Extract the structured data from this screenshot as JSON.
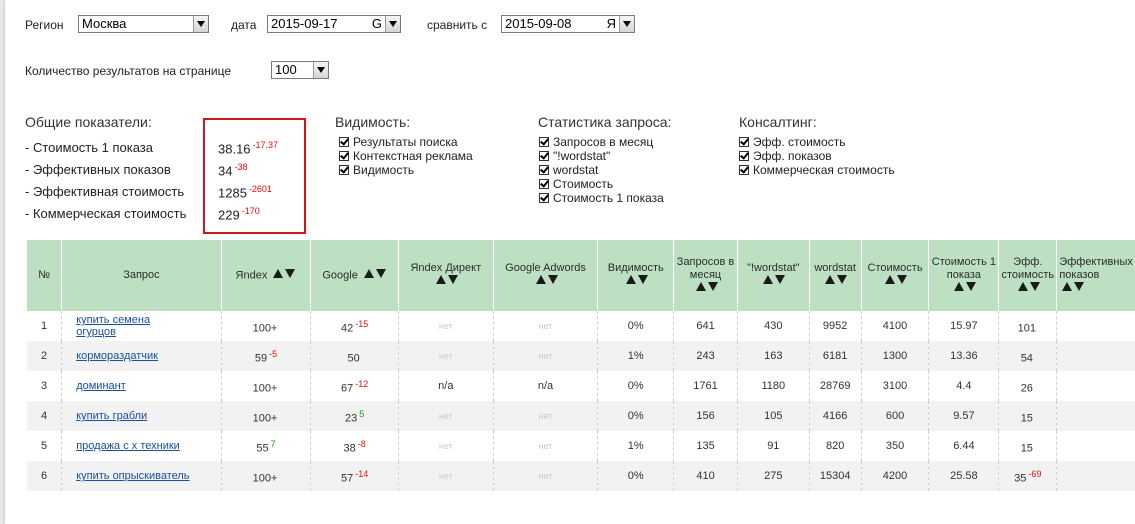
{
  "filters": {
    "region_label": "Регион",
    "region_value": "Москва",
    "date_label": "дата",
    "date_value": "2015-09-17",
    "date_suffix": "G",
    "compare_label": "сравнить с",
    "compare_value": "2015-09-08",
    "compare_suffix": "Я",
    "per_page_label": "Количество результатов на странице",
    "per_page_value": "100"
  },
  "summary": {
    "title": "Общие показатели:",
    "rows": [
      {
        "label": "- Стоимость 1 показа",
        "value": "38.16",
        "delta": "-17.37"
      },
      {
        "label": "- Эффективных показов",
        "value": "34",
        "delta": "-38"
      },
      {
        "label": "- Эффективная стоимость",
        "value": "1285",
        "delta": "-2601"
      },
      {
        "label": "- Коммерческая стоимость",
        "value": "229",
        "delta": "-170"
      }
    ],
    "highlight_color": "#d4141c"
  },
  "visibility": {
    "title": "Видимость:",
    "options": [
      "Результаты поиска",
      "Контекстная реклама",
      "Видимость"
    ]
  },
  "query_stats": {
    "title": "Статистика запроса:",
    "options": [
      "Запросов в месяц",
      "\"!wordstat\"",
      "wordstat",
      "Стоимость",
      "Стоимость 1 показа"
    ]
  },
  "consulting": {
    "title": "Консалтинг:",
    "options": [
      "Эфф. стоимость",
      "Эфф. показов",
      "Коммерческая стоимость"
    ]
  },
  "table": {
    "header_color": "#bde0c2",
    "headers": [
      "№",
      "Запрос",
      "Яndex",
      "Google",
      "Яndex Директ",
      "Google Adwords",
      "Видимость",
      "Запросов в месяц",
      "\"!wordstat\"",
      "wordstat",
      "Стоимость",
      "Стоимость 1 показа",
      "Эфф. стоимость",
      "Эффективных показов"
    ],
    "rows": [
      {
        "n": "1",
        "query": "купить семена огурцов",
        "yandex": "100+",
        "yandex_delta": "",
        "google": "42",
        "google_delta": "-15",
        "ydirect": "нет",
        "adwords": "нет",
        "visibility": "0%",
        "month": "641",
        "wsq": "430",
        "ws": "9952",
        "cost": "4100",
        "cost1": "15.97",
        "effcost": "101",
        "effcost_delta": ""
      },
      {
        "n": "2",
        "query": "кормораздатчик",
        "yandex": "59",
        "yandex_delta": "-5",
        "google": "50",
        "google_delta": "",
        "ydirect": "нет",
        "adwords": "нет",
        "visibility": "1%",
        "month": "243",
        "wsq": "163",
        "ws": "6181",
        "cost": "1300",
        "cost1": "13.36",
        "effcost": "54",
        "effcost_delta": ""
      },
      {
        "n": "3",
        "query": "доминант",
        "yandex": "100+",
        "yandex_delta": "",
        "google": "67",
        "google_delta": "-12",
        "ydirect": "n/a",
        "adwords": "n/a",
        "visibility": "0%",
        "month": "1761",
        "wsq": "1180",
        "ws": "28769",
        "cost": "3100",
        "cost1": "4.4",
        "effcost": "26",
        "effcost_delta": ""
      },
      {
        "n": "4",
        "query": "купить грабли",
        "yandex": "100+",
        "yandex_delta": "",
        "google": "23",
        "google_delta": "5",
        "ydirect": "нет",
        "adwords": "нет",
        "visibility": "0%",
        "month": "156",
        "wsq": "105",
        "ws": "4166",
        "cost": "600",
        "cost1": "9.57",
        "effcost": "15",
        "effcost_delta": ""
      },
      {
        "n": "5",
        "query": "продажа с х техники",
        "yandex": "55",
        "yandex_delta": "7",
        "google": "38",
        "google_delta": "-8",
        "ydirect": "нет",
        "adwords": "нет",
        "visibility": "1%",
        "month": "135",
        "wsq": "91",
        "ws": "820",
        "cost": "350",
        "cost1": "6.44",
        "effcost": "15",
        "effcost_delta": ""
      },
      {
        "n": "6",
        "query": "купить опрыскиватель",
        "yandex": "100+",
        "yandex_delta": "",
        "google": "57",
        "google_delta": "-14",
        "ydirect": "нет",
        "adwords": "нет",
        "visibility": "0%",
        "month": "410",
        "wsq": "275",
        "ws": "15304",
        "cost": "4200",
        "cost1": "25.58",
        "effcost": "35",
        "effcost_delta": "-69"
      }
    ]
  }
}
